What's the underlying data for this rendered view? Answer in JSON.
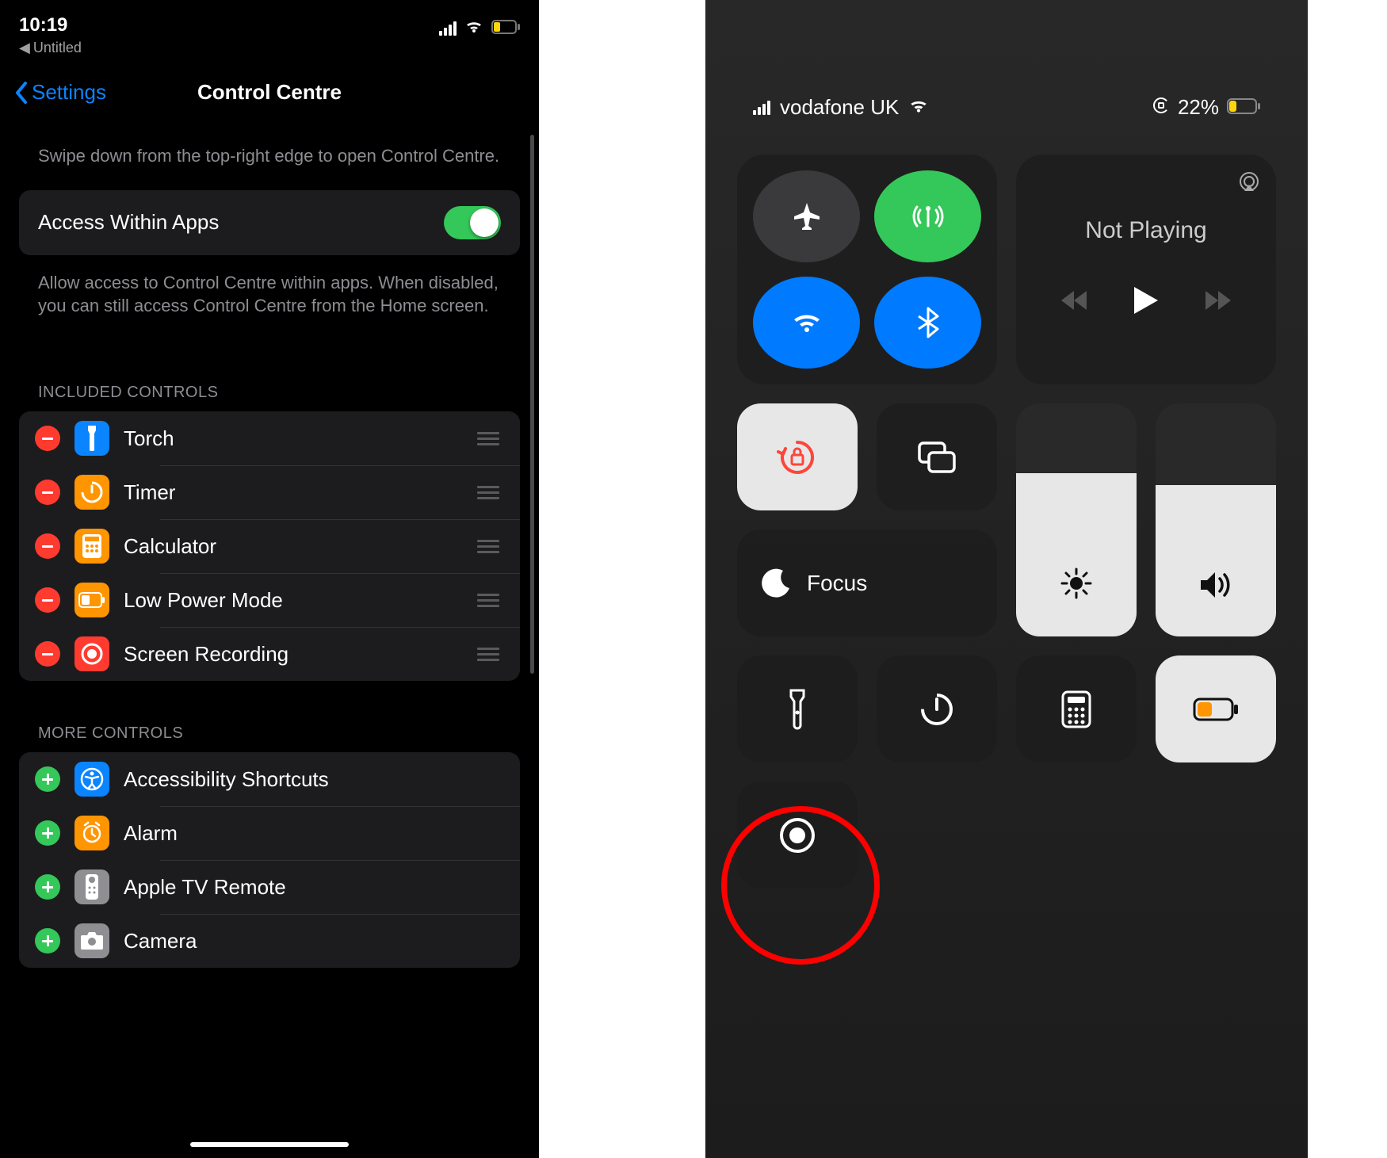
{
  "left": {
    "status": {
      "time": "10:19",
      "breadcrumb_icon": "◀",
      "breadcrumb": "Untitled"
    },
    "nav": {
      "back_label": "Settings",
      "title": "Control Centre"
    },
    "hint_top": "Swipe down from the top-right edge to open Control Centre.",
    "access": {
      "label": "Access Within Apps",
      "enabled": true
    },
    "hint_access": "Allow access to Control Centre within apps. When disabled, you can still access Control Centre from the Home screen.",
    "section_included": "INCLUDED CONTROLS",
    "included": [
      {
        "label": "Torch",
        "icon": "torch",
        "color": "#0a84ff"
      },
      {
        "label": "Timer",
        "icon": "timer",
        "color": "#ff9500"
      },
      {
        "label": "Calculator",
        "icon": "calculator",
        "color": "#ff9500"
      },
      {
        "label": "Low Power Mode",
        "icon": "battery",
        "color": "#ff9500"
      },
      {
        "label": "Screen Recording",
        "icon": "record",
        "color": "#ff3b30"
      }
    ],
    "section_more": "MORE CONTROLS",
    "more": [
      {
        "label": "Accessibility Shortcuts",
        "icon": "accessibility",
        "color": "#0a84ff"
      },
      {
        "label": "Alarm",
        "icon": "alarm",
        "color": "#ff9500"
      },
      {
        "label": "Apple TV Remote",
        "icon": "remote",
        "color": "#8e8e93"
      },
      {
        "label": "Camera",
        "icon": "camera",
        "color": "#8e8e93"
      }
    ]
  },
  "right": {
    "status": {
      "carrier": "vodafone UK",
      "battery_pct": "22%"
    },
    "media": {
      "title": "Not Playing"
    },
    "focus_label": "Focus",
    "brightness_pct": 70,
    "volume_pct": 65,
    "rotation_locked": true,
    "low_power_on": true
  }
}
